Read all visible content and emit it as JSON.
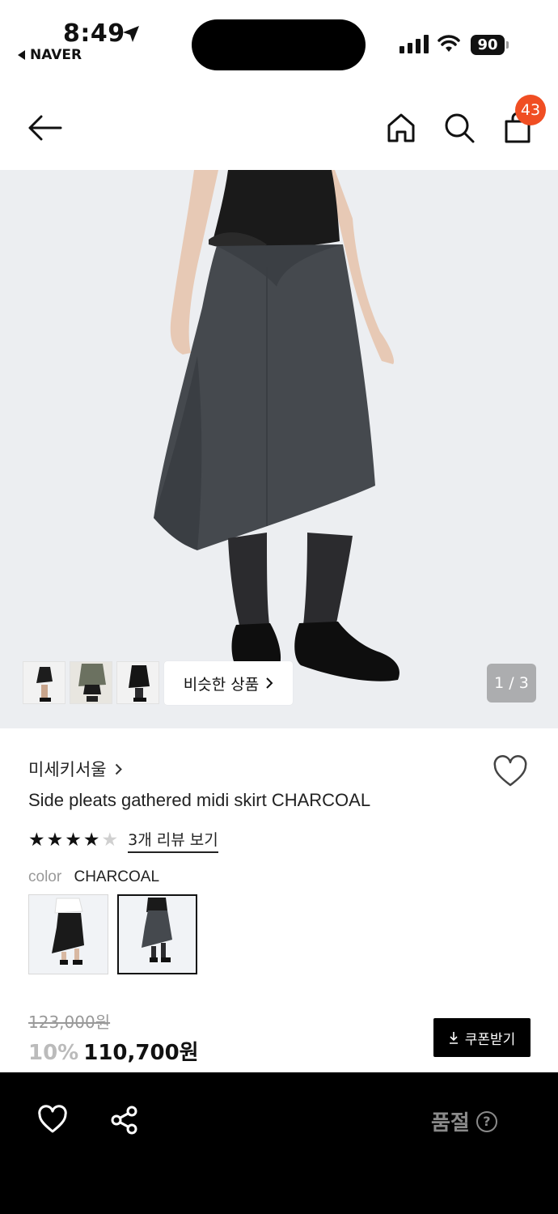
{
  "status_bar": {
    "time": "8:49",
    "back_app": "NAVER",
    "battery": "90"
  },
  "header": {
    "cart_count": "43"
  },
  "gallery": {
    "similar_label": "비슷한 상품",
    "page_indicator": "1 / 3"
  },
  "product": {
    "brand": "미세키서울",
    "title": "Side pleats gathered midi skirt CHARCOAL",
    "rating_stars": 4,
    "review_link": "3개 리뷰 보기",
    "color_label": "color",
    "color_value": "CHARCOAL",
    "original_price": "123,000원",
    "discount": "10%",
    "price": "110,700원",
    "coupon_label": "쿠폰받기"
  },
  "bottom_bar": {
    "soldout_label": "품절",
    "help_glyph": "?"
  },
  "colors": {
    "badge": "#f04e23",
    "skirt": "#45494e",
    "bottom_bar": "#000000"
  }
}
